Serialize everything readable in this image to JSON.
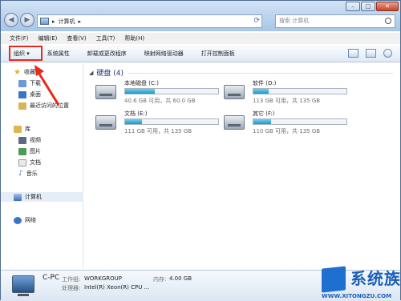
{
  "window": {
    "breadcrumb": "计算机",
    "search_placeholder": "搜索 计算机"
  },
  "menu": [
    "文件(F)",
    "编辑(E)",
    "查看(V)",
    "工具(T)",
    "帮助(H)"
  ],
  "toolbar": {
    "organize": "组织 ▾",
    "items": [
      "系统属性",
      "卸载或更改程序",
      "映射网络驱动器",
      "打开控制面板"
    ]
  },
  "sidebar": {
    "favorites_label": "收藏夹",
    "favorites": [
      "下载",
      "桌面",
      "最近访问的位置"
    ],
    "libraries_label": "库",
    "libraries": [
      "视频",
      "图片",
      "文档",
      "音乐"
    ],
    "computer_label": "计算机",
    "network_label": "网络"
  },
  "content": {
    "group_title": "硬盘 (4)",
    "drives": [
      {
        "name": "本地磁盘 (C:)",
        "space": "40.6 GB 可用，共 60.0 GB",
        "used_fraction": 0.32
      },
      {
        "name": "软件 (D:)",
        "space": "113 GB 可用，共 135 GB",
        "used_fraction": 0.16
      },
      {
        "name": "文档 (E:)",
        "space": "111 GB 可用，共 135 GB",
        "used_fraction": 0.18
      },
      {
        "name": "其它 (F:)",
        "space": "110 GB 可用，共 135 GB",
        "used_fraction": 0.19
      }
    ]
  },
  "details": {
    "pc_name": "C-PC",
    "workgroup_label": "工作组:",
    "workgroup": "WORKGROUP",
    "memory_label": "内存:",
    "memory": "4.00 GB",
    "processor_label": "处理器:",
    "processor": "Intel(R) Xeon(R) CPU ..."
  },
  "watermark": {
    "text": "系统族",
    "url": "WWW.XITONGZU.COM"
  }
}
